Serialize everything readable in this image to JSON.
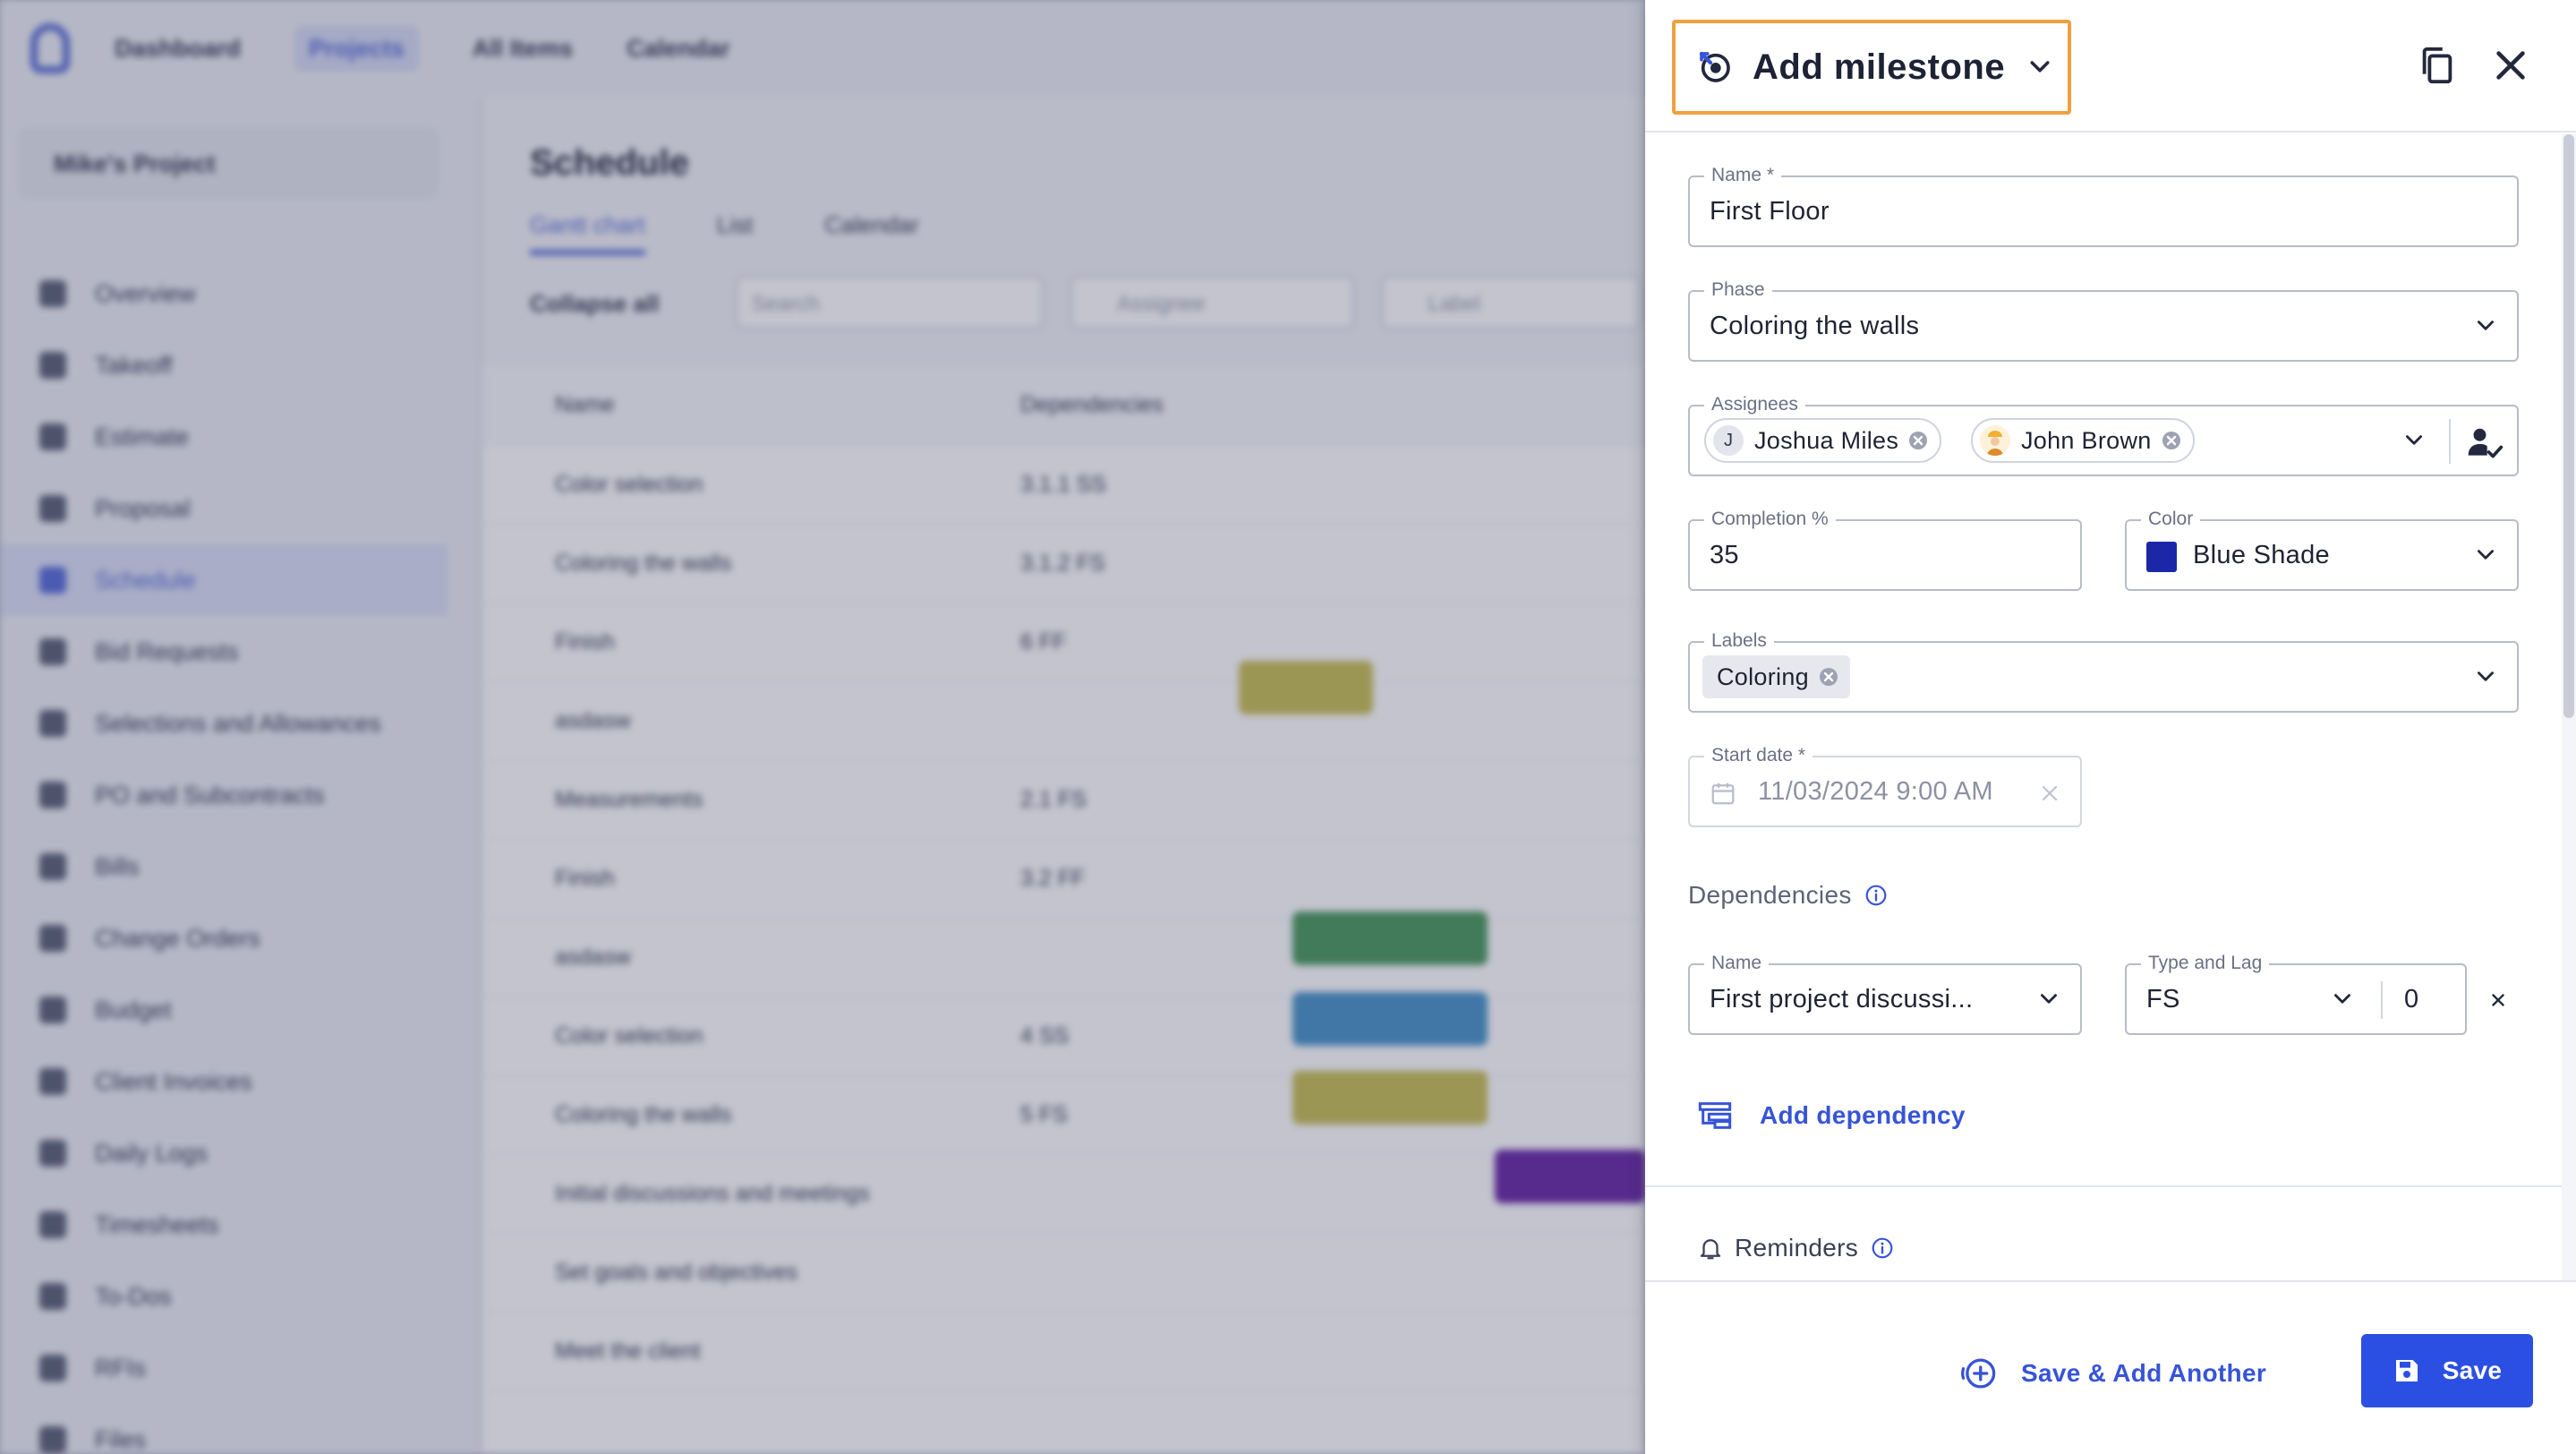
{
  "background": {
    "nav": [
      "Dashboard",
      "Projects",
      "All Items",
      "Calendar"
    ],
    "project": "Mike's Project",
    "sidebar": [
      "Overview",
      "Takeoff",
      "Estimate",
      "Proposal",
      "Schedule",
      "Bid Requests",
      "Selections and Allowances",
      "PO and Subcontracts",
      "Bills",
      "Change Orders",
      "Budget",
      "Client Invoices",
      "Daily Logs",
      "Timesheets",
      "To-Dos",
      "RFIs",
      "Files"
    ],
    "page_title": "Schedule",
    "tabs": [
      "Gantt chart",
      "List",
      "Calendar"
    ],
    "collapse_label": "Collapse all",
    "search_placeholder": "Search",
    "assignee_placeholder": "Assignee",
    "label_placeholder": "Label",
    "columns": [
      "Name",
      "Dependencies"
    ],
    "rows": [
      {
        "name": "Color selection",
        "dep": "3.1.1 SS"
      },
      {
        "name": "Coloring the walls",
        "dep": "3.1.2 FS"
      },
      {
        "name": "Finish",
        "dep": "6 FF"
      },
      {
        "name": "asdasw",
        "dep": ""
      },
      {
        "name": "Measurements",
        "dep": "2.1 FS"
      },
      {
        "name": "Finish",
        "dep": "3.2 FF"
      },
      {
        "name": "asdasw",
        "dep": ""
      },
      {
        "name": "Color selection",
        "dep": "4 SS"
      },
      {
        "name": "Coloring the walls",
        "dep": "5 FS"
      },
      {
        "name": "Initial discussions and meetings",
        "dep": ""
      },
      {
        "name": "Set goals and objectives",
        "dep": ""
      },
      {
        "name": "Meet the client",
        "dep": ""
      }
    ],
    "bar_colors": {
      "yellow": "#c9bf58",
      "green": "#4c9a5e",
      "blue": "#4a95c9",
      "purple": "#6a2aa6"
    }
  },
  "drawer": {
    "title": "Add milestone",
    "name": {
      "label": "Name *",
      "value": "First Floor"
    },
    "phase": {
      "label": "Phase",
      "value": "Coloring the walls"
    },
    "assignees": {
      "label": "Assignees",
      "items": [
        {
          "initial": "J",
          "name": "Joshua Miles"
        },
        {
          "initial": "",
          "name": "John Brown"
        }
      ]
    },
    "completion": {
      "label": "Completion %",
      "value": "35"
    },
    "color": {
      "label": "Color",
      "value": "Blue Shade",
      "swatch": "#1c27a8"
    },
    "labels": {
      "label": "Labels",
      "tags": [
        "Coloring"
      ]
    },
    "start_date": {
      "label": "Start date *",
      "value": "11/03/2024 9:00 AM"
    },
    "dependencies": {
      "title": "Dependencies",
      "name_label": "Name",
      "name_value": "First project discussi...",
      "type_label": "Type and Lag",
      "type_value": "FS",
      "lag_value": "0",
      "add_label": "Add dependency"
    },
    "reminders": {
      "title": "Reminders"
    },
    "footer": {
      "save_add_another": "Save & Add Another",
      "save": "Save"
    },
    "accent": "#3754d8",
    "highlight": "#f0a040"
  }
}
